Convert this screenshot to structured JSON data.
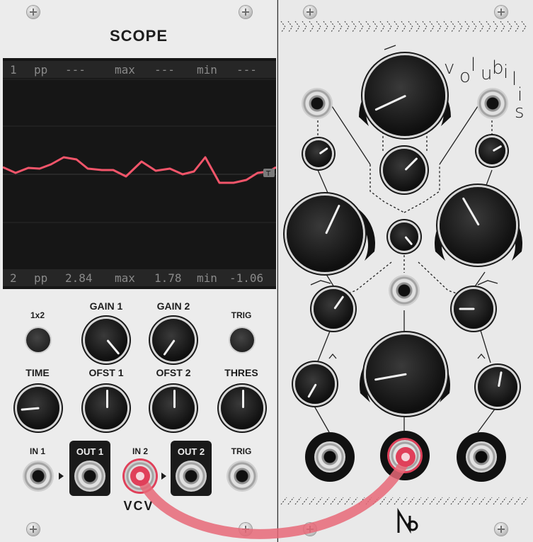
{
  "scope": {
    "title": "SCOPE",
    "brand": "VCV",
    "stat1": {
      "channel": "1",
      "pp_label": "pp",
      "pp": "---",
      "max_label": "max",
      "max": "---",
      "min_label": "min",
      "min": "---"
    },
    "stat2": {
      "channel": "2",
      "pp_label": "pp",
      "pp": "2.84",
      "max_label": "max",
      "max": "1.78",
      "min_label": "min",
      "min": "-1.06"
    },
    "labels": {
      "mode": "1x2",
      "gain1": "GAIN 1",
      "gain2": "GAIN 2",
      "trig_button": "TRIG",
      "time": "TIME",
      "ofst1": "OFST 1",
      "ofst2": "OFST 2",
      "thres": "THRES",
      "in1": "IN 1",
      "out1": "OUT 1",
      "in2": "IN 2",
      "out2": "OUT 2",
      "trig_input": "TRIG"
    },
    "trace_color": "#f2556a",
    "trigger_marker": "T"
  },
  "voltage": {
    "title_word": "volubilis",
    "letters": [
      "v",
      "o",
      "l",
      "u",
      "b",
      "i",
      "l",
      "i",
      "s"
    ],
    "accent_color": "#e0405a"
  },
  "cable": {
    "color": "#e86878",
    "from": "IN 2",
    "to": "voltage-center-output"
  }
}
